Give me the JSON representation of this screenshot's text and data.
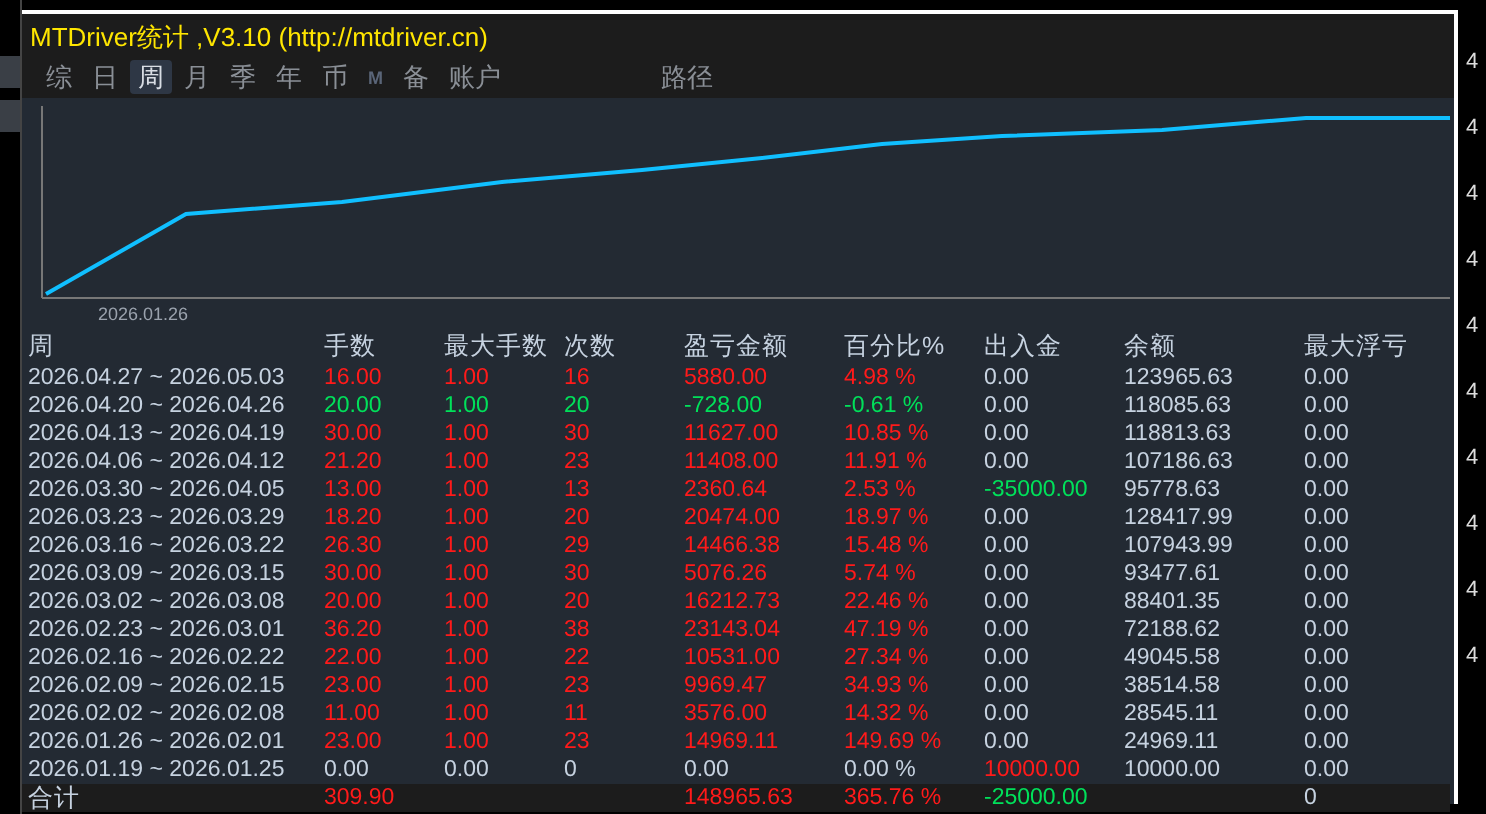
{
  "window": {
    "title": "MTDriver统计 ,V3.10 (http://mtdriver.cn)"
  },
  "tabs": [
    {
      "label": "综",
      "selected": false
    },
    {
      "label": "日",
      "selected": false
    },
    {
      "label": "周",
      "selected": true
    },
    {
      "label": "月",
      "selected": false
    },
    {
      "label": "季",
      "selected": false
    },
    {
      "label": "年",
      "selected": false
    },
    {
      "label": "币",
      "selected": false
    },
    {
      "label": "M",
      "selected": false
    },
    {
      "label": "备",
      "selected": false
    },
    {
      "label": "账户",
      "selected": false
    }
  ],
  "path_button": {
    "label": "路径"
  },
  "equity_chart": {
    "x_label": "2026.01.26"
  },
  "table": {
    "columns": [
      "周",
      "手数",
      "最大手数",
      "次数",
      "盈亏金额",
      "百分比%",
      "出入金",
      "余额",
      "最大浮亏"
    ],
    "rows": [
      {
        "week": "2026.04.27 ~ 2026.05.03",
        "lots": "16.00",
        "max_lots": "1.00",
        "count": "16",
        "pnl": "5880.00",
        "pct": "4.98 %",
        "deposit": {
          "text": "0.00",
          "color": "#c6d2e0"
        },
        "balance": "123965.63",
        "max_float": "0.00",
        "color": "#ff1a1a"
      },
      {
        "week": "2026.04.20 ~ 2026.04.26",
        "lots": "20.00",
        "max_lots": "1.00",
        "count": "20",
        "pnl": "-728.00",
        "pct": "-0.61 %",
        "deposit": {
          "text": "0.00",
          "color": "#c6d2e0"
        },
        "balance": "118085.63",
        "max_float": "0.00",
        "color": "#00e05a"
      },
      {
        "week": "2026.04.13 ~ 2026.04.19",
        "lots": "30.00",
        "max_lots": "1.00",
        "count": "30",
        "pnl": "11627.00",
        "pct": "10.85 %",
        "deposit": {
          "text": "0.00",
          "color": "#c6d2e0"
        },
        "balance": "118813.63",
        "max_float": "0.00",
        "color": "#ff1a1a"
      },
      {
        "week": "2026.04.06 ~ 2026.04.12",
        "lots": "21.20",
        "max_lots": "1.00",
        "count": "23",
        "pnl": "11408.00",
        "pct": "11.91 %",
        "deposit": {
          "text": "0.00",
          "color": "#c6d2e0"
        },
        "balance": "107186.63",
        "max_float": "0.00",
        "color": "#ff1a1a"
      },
      {
        "week": "2026.03.30 ~ 2026.04.05",
        "lots": "13.00",
        "max_lots": "1.00",
        "count": "13",
        "pnl": "2360.64",
        "pct": "2.53 %",
        "deposit": {
          "text": "-35000.00",
          "color": "#00e05a"
        },
        "balance": "95778.63",
        "max_float": "0.00",
        "color": "#ff1a1a"
      },
      {
        "week": "2026.03.23 ~ 2026.03.29",
        "lots": "18.20",
        "max_lots": "1.00",
        "count": "20",
        "pnl": "20474.00",
        "pct": "18.97 %",
        "deposit": {
          "text": "0.00",
          "color": "#c6d2e0"
        },
        "balance": "128417.99",
        "max_float": "0.00",
        "color": "#ff1a1a"
      },
      {
        "week": "2026.03.16 ~ 2026.03.22",
        "lots": "26.30",
        "max_lots": "1.00",
        "count": "29",
        "pnl": "14466.38",
        "pct": "15.48 %",
        "deposit": {
          "text": "0.00",
          "color": "#c6d2e0"
        },
        "balance": "107943.99",
        "max_float": "0.00",
        "color": "#ff1a1a"
      },
      {
        "week": "2026.03.09 ~ 2026.03.15",
        "lots": "30.00",
        "max_lots": "1.00",
        "count": "30",
        "pnl": "5076.26",
        "pct": "5.74 %",
        "deposit": {
          "text": "0.00",
          "color": "#c6d2e0"
        },
        "balance": "93477.61",
        "max_float": "0.00",
        "color": "#ff1a1a"
      },
      {
        "week": "2026.03.02 ~ 2026.03.08",
        "lots": "20.00",
        "max_lots": "1.00",
        "count": "20",
        "pnl": "16212.73",
        "pct": "22.46 %",
        "deposit": {
          "text": "0.00",
          "color": "#c6d2e0"
        },
        "balance": "88401.35",
        "max_float": "0.00",
        "color": "#ff1a1a"
      },
      {
        "week": "2026.02.23 ~ 2026.03.01",
        "lots": "36.20",
        "max_lots": "1.00",
        "count": "38",
        "pnl": "23143.04",
        "pct": "47.19 %",
        "deposit": {
          "text": "0.00",
          "color": "#c6d2e0"
        },
        "balance": "72188.62",
        "max_float": "0.00",
        "color": "#ff1a1a"
      },
      {
        "week": "2026.02.16 ~ 2026.02.22",
        "lots": "22.00",
        "max_lots": "1.00",
        "count": "22",
        "pnl": "10531.00",
        "pct": "27.34 %",
        "deposit": {
          "text": "0.00",
          "color": "#c6d2e0"
        },
        "balance": "49045.58",
        "max_float": "0.00",
        "color": "#ff1a1a"
      },
      {
        "week": "2026.02.09 ~ 2026.02.15",
        "lots": "23.00",
        "max_lots": "1.00",
        "count": "23",
        "pnl": "9969.47",
        "pct": "34.93 %",
        "deposit": {
          "text": "0.00",
          "color": "#c6d2e0"
        },
        "balance": "38514.58",
        "max_float": "0.00",
        "color": "#ff1a1a"
      },
      {
        "week": "2026.02.02 ~ 2026.02.08",
        "lots": "11.00",
        "max_lots": "1.00",
        "count": "11",
        "pnl": "3576.00",
        "pct": "14.32 %",
        "deposit": {
          "text": "0.00",
          "color": "#c6d2e0"
        },
        "balance": "28545.11",
        "max_float": "0.00",
        "color": "#ff1a1a"
      },
      {
        "week": "2026.01.26 ~ 2026.02.01",
        "lots": "23.00",
        "max_lots": "1.00",
        "count": "23",
        "pnl": "14969.11",
        "pct": "149.69 %",
        "deposit": {
          "text": "0.00",
          "color": "#c6d2e0"
        },
        "balance": "24969.11",
        "max_float": "0.00",
        "color": "#ff1a1a"
      },
      {
        "week": "2026.01.19 ~ 2026.01.25",
        "lots": "0.00",
        "max_lots": "0.00",
        "count": "0",
        "pnl": "0.00",
        "pct": "0.00 %",
        "deposit": {
          "text": "10000.00",
          "color": "#ff1a1a"
        },
        "balance": "10000.00",
        "max_float": "0.00",
        "color": "#c6d2e0"
      }
    ],
    "total": {
      "label": "合计",
      "lots": "309.90",
      "pnl": "148965.63",
      "pct": "365.76 %",
      "deposit": {
        "text": "-25000.00",
        "color": "#00e05a"
      },
      "max_float": "0",
      "color": "#ff1a1a"
    }
  },
  "price_axis": [
    "4",
    "4",
    "4",
    "4",
    "4",
    "4",
    "4",
    "4",
    "4",
    "4"
  ]
}
